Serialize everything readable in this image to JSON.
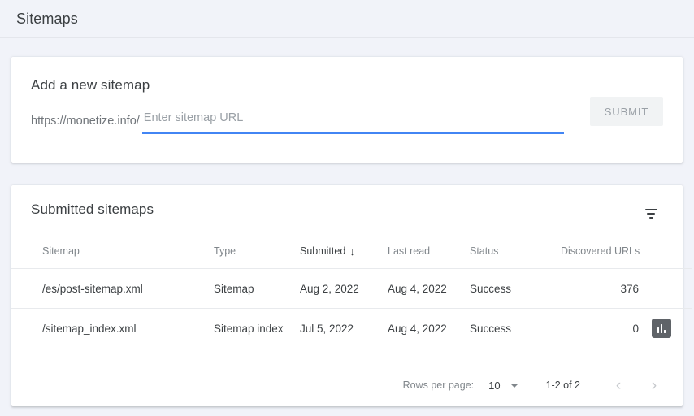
{
  "header": {
    "title": "Sitemaps"
  },
  "add_sitemap": {
    "heading": "Add a new sitemap",
    "url_prefix": "https://monetize.info/",
    "input_value": "",
    "input_placeholder": "Enter sitemap URL",
    "submit_label": "SUBMIT",
    "accent_color": "#4285f4",
    "submit_disabled_bg": "#f1f3f4",
    "submit_disabled_text": "#9aa0a6"
  },
  "submitted_sitemaps": {
    "heading": "Submitted sitemaps",
    "filter_icon": "filter-list-icon",
    "columns": [
      {
        "key": "sitemap",
        "label": "Sitemap",
        "sorted": false,
        "align": "left"
      },
      {
        "key": "type",
        "label": "Type",
        "sorted": false,
        "align": "left"
      },
      {
        "key": "submitted",
        "label": "Submitted",
        "sorted": true,
        "align": "left",
        "sort_arrow": "↓"
      },
      {
        "key": "lastread",
        "label": "Last read",
        "sorted": false,
        "align": "left"
      },
      {
        "key": "status",
        "label": "Status",
        "sorted": false,
        "align": "left"
      },
      {
        "key": "urls",
        "label": "Discovered URLs",
        "sorted": false,
        "align": "right"
      }
    ],
    "rows": [
      {
        "sitemap": "/es/post-sitemap.xml",
        "type": "Sitemap",
        "submitted": "Aug 2, 2022",
        "lastread": "Aug 4, 2022",
        "status": "Success",
        "status_color": "#188038",
        "urls": "376",
        "action_icon": ""
      },
      {
        "sitemap": "/sitemap_index.xml",
        "type": "Sitemap index",
        "submitted": "Jul 5, 2022",
        "lastread": "Aug 4, 2022",
        "status": "Success",
        "status_color": "#188038",
        "urls": "0",
        "action_icon": "bar-chart-icon"
      }
    ],
    "pagination": {
      "rows_per_page_label": "Rows per page:",
      "rows_per_page_value": "10",
      "range_label": "1-2 of 2",
      "prev_glyph": "‹",
      "next_glyph": "›"
    }
  }
}
